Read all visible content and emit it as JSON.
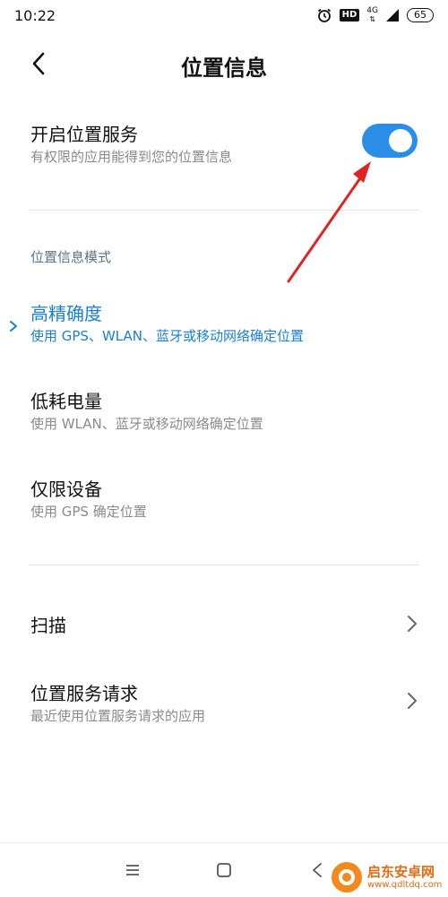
{
  "status_bar": {
    "time": "10:22",
    "hd": "HD",
    "network": "4G",
    "battery": "65"
  },
  "header": {
    "title": "位置信息"
  },
  "location_service": {
    "title": "开启位置服务",
    "subtitle": "有权限的应用能得到您的位置信息",
    "enabled": true
  },
  "mode_section": {
    "label": "位置信息模式",
    "items": [
      {
        "title": "高精确度",
        "subtitle": "使用 GPS、WLAN、蓝牙或移动网络确定位置",
        "selected": true
      },
      {
        "title": "低耗电量",
        "subtitle": "使用 WLAN、蓝牙或移动网络确定位置",
        "selected": false
      },
      {
        "title": "仅限设备",
        "subtitle": "使用 GPS 确定位置",
        "selected": false
      }
    ]
  },
  "other_settings": [
    {
      "title": "扫描"
    },
    {
      "title": "位置服务请求",
      "subtitle": "最近使用位置服务请求的应用"
    }
  ],
  "watermark": {
    "name": "启东安卓网",
    "url": "www.qdltdq.com"
  },
  "colors": {
    "accent": "#2c8de6",
    "selected_text": "#1a7fd4",
    "annotation": "#e02424"
  }
}
